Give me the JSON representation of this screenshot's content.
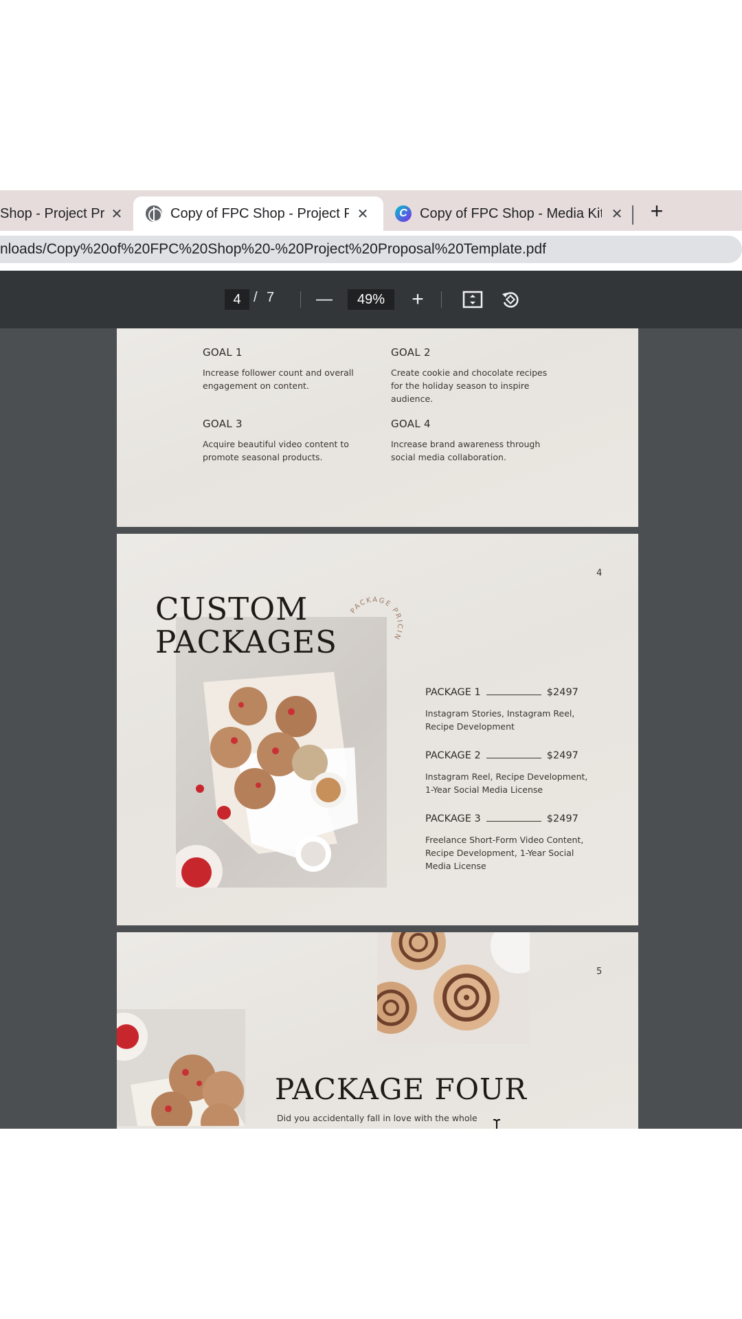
{
  "browser": {
    "tabs": [
      {
        "title": "Shop - Project Pro",
        "icon": "globe-icon",
        "active": false
      },
      {
        "title": "Copy of FPC Shop - Project Pro",
        "icon": "globe-icon",
        "active": true
      },
      {
        "title": "Copy of FPC Shop - Media Kit T",
        "icon": "canva-icon",
        "active": false
      }
    ],
    "close_glyph": "✕",
    "new_tab_glyph": "+",
    "address": "nloads/Copy%20of%20FPC%20Shop%20-%20Project%20Proposal%20Template.pdf"
  },
  "pdf_toolbar": {
    "current_page": "4",
    "separator": "/",
    "total_pages": "7",
    "zoom_out_glyph": "—",
    "zoom": "49%",
    "zoom_in_glyph": "+",
    "fit_icon": "fit-page-icon",
    "rotate_icon": "rotate-icon"
  },
  "page3": {
    "goals": [
      {
        "heading": "GOAL 1",
        "text": "Increase follower count and overall engagement on content."
      },
      {
        "heading": "GOAL 2",
        "text": "Create cookie and chocolate recipes for the holiday season to inspire audience."
      },
      {
        "heading": "GOAL 3",
        "text": "Acquire beautiful video content to promote seasonal products."
      },
      {
        "heading": "GOAL 4",
        "text": "Increase brand awareness through social media collaboration."
      }
    ]
  },
  "page4": {
    "page_number": "4",
    "title_line1": "CUSTOM",
    "title_line2": "PACKAGES",
    "circle_text": "PACKAGE PRICIN",
    "packages": [
      {
        "name": "PACKAGE 1",
        "price": "$2497",
        "description": "Instagram Stories, Instagram Reel, Recipe Development"
      },
      {
        "name": "PACKAGE 2",
        "price": "$2497",
        "description": "Instagram Reel, Recipe Development, 1-Year Social Media License"
      },
      {
        "name": "PACKAGE 3",
        "price": "$2497",
        "description": "Freelance Short-Form Video Content, Recipe Development, 1-Year Social Media License"
      }
    ]
  },
  "page5": {
    "page_number": "5",
    "title": "PACKAGE FOUR",
    "body": "Did you accidentally fall in love with the whole"
  },
  "colors": {
    "tab_strip": "#e6dcdc",
    "pdf_toolbar": "#323639",
    "viewer_bg": "#4b4f52",
    "page_bg": "#eae7e3",
    "accent_text": "#9c7a65"
  }
}
